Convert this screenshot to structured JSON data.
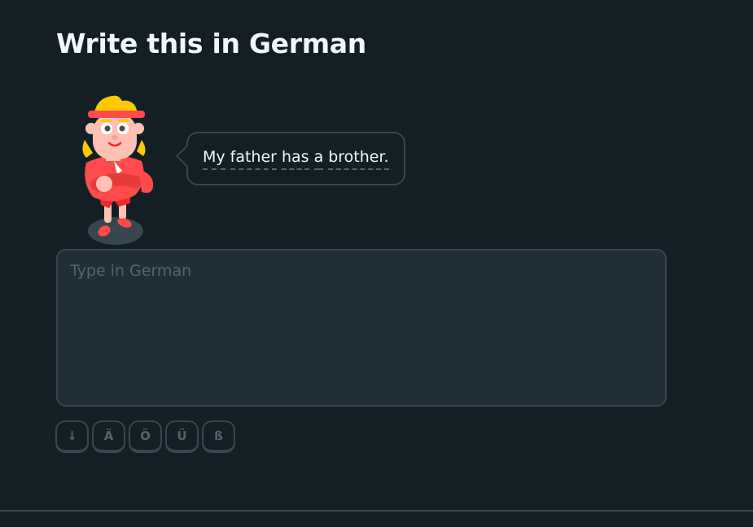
{
  "header": {
    "title": "Write this in German"
  },
  "prompt": {
    "words": [
      "My",
      "father",
      "has",
      "a",
      "brother."
    ]
  },
  "answer": {
    "placeholder": "Type in German",
    "value": ""
  },
  "keyboard": {
    "keys": [
      {
        "label": "↓",
        "icon": "arrow-down-icon"
      },
      {
        "label": "Ä"
      },
      {
        "label": "Ö"
      },
      {
        "label": "Ü"
      },
      {
        "label": "ß"
      }
    ]
  },
  "colors": {
    "background": "#131f24",
    "border": "#37464f",
    "input_background": "#202f36",
    "text": "#f1f7fb",
    "muted": "#52656d",
    "character_shirt": "#ff4b4b",
    "character_hair": "#ffc800"
  }
}
